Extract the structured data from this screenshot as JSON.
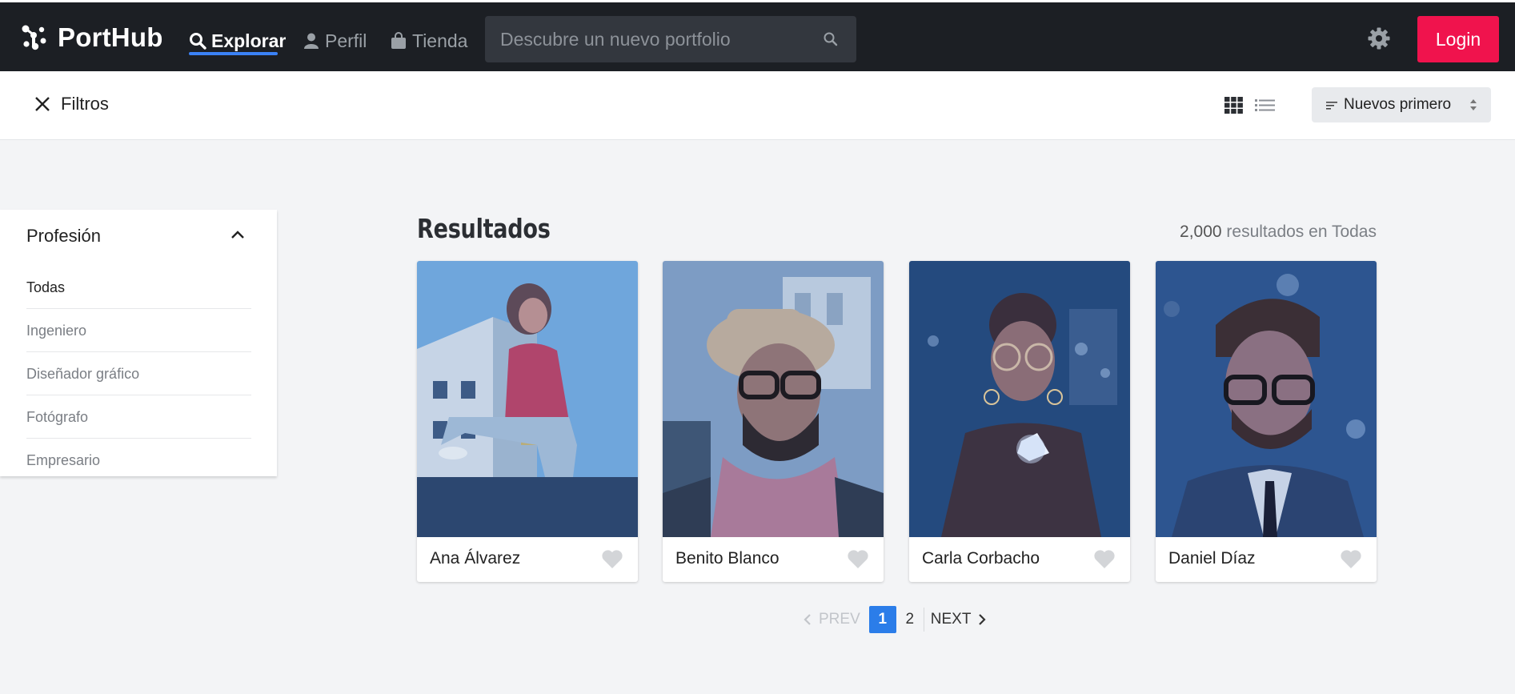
{
  "nav": {
    "brand": "PortHub",
    "items": [
      {
        "label": "Explorar",
        "icon": "search-icon",
        "active": true
      },
      {
        "label": "Perfil",
        "icon": "user-icon",
        "active": false
      },
      {
        "label": "Tienda",
        "icon": "shopping-bag-icon",
        "active": false
      }
    ],
    "search_placeholder": "Descubre un nuevo portfolio",
    "login_label": "Login",
    "accent_color": "#f0134d",
    "active_underline_color": "#3b82f6"
  },
  "filterbar": {
    "toggle_label": "Filtros",
    "sort_label": "Nuevos primero"
  },
  "sidebar": {
    "heading": "Profesión",
    "items": [
      "Todas",
      "Ingeniero",
      "Diseñador gráfico",
      "Fotógrafo",
      "Empresario"
    ],
    "selected": "Todas"
  },
  "results": {
    "title": "Resultados",
    "count": "2,000",
    "count_suffix": " resultados en Todas",
    "cards": [
      {
        "name": "Ana Álvarez"
      },
      {
        "name": "Benito Blanco"
      },
      {
        "name": "Carla Corbacho"
      },
      {
        "name": "Daniel Díaz"
      }
    ]
  },
  "pagination": {
    "prev": "PREV",
    "pages": [
      "1",
      "2"
    ],
    "current": "1",
    "next": "NEXT"
  }
}
